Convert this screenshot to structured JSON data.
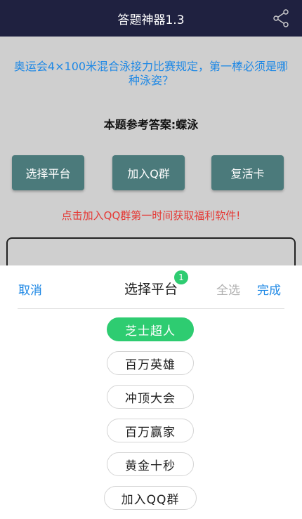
{
  "app": {
    "title": "答题神器1.3",
    "share_icon": "share-icon"
  },
  "question": "奥运会4×100米混合泳接力比赛规定，第一棒必须是哪种泳姿？",
  "answer_line": "本题参考答案:蝶泳",
  "buttons": {
    "select_platform": "选择平台",
    "join_q_group": "加入Q群",
    "revive_card": "复活卡"
  },
  "notice": "点击加入QQ群第一时间获取福利软件!",
  "colors": {
    "titlebar": "#1f2140",
    "question": "#1e88e5",
    "notice": "#e53935",
    "button": "#4b7a7b",
    "selected_chip": "#2ecc71"
  },
  "sheet": {
    "cancel": "取消",
    "title": "选择平台",
    "badge": "1",
    "select_all": "全选",
    "done": "完成",
    "options": [
      {
        "label": "芝士超人",
        "selected": true
      },
      {
        "label": "百万英雄",
        "selected": false
      },
      {
        "label": "冲顶大会",
        "selected": false
      },
      {
        "label": "百万赢家",
        "selected": false
      },
      {
        "label": "黄金十秒",
        "selected": false
      },
      {
        "label": "加入QQ群",
        "selected": false
      }
    ]
  }
}
